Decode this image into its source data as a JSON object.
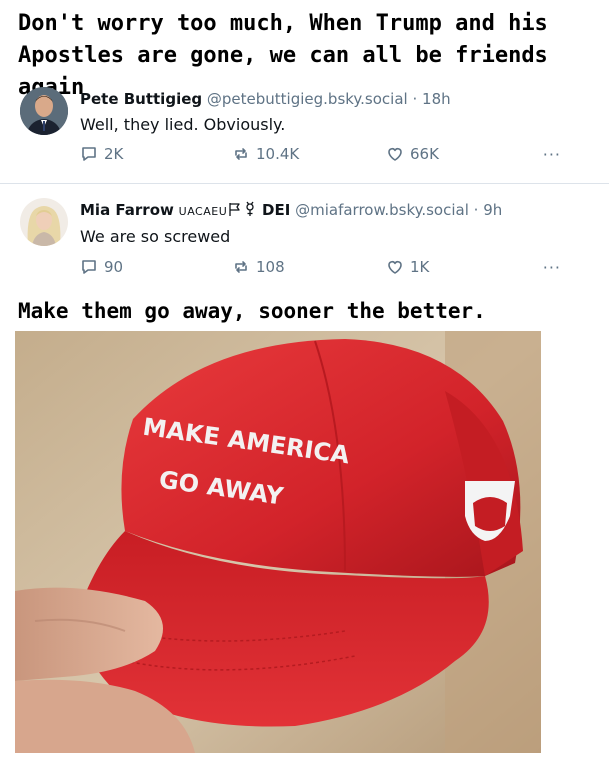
{
  "caption_top": {
    "line1": "Don't worry too much, When Trump and his",
    "line2": "Apostles are gone, we can all be friends again"
  },
  "posts": [
    {
      "name": "Pete Buttigieg",
      "handle": "@petebuttigieg.bsky.social",
      "time": "· 18h",
      "text": "Well, they lied. Obviously.",
      "replies": "2K",
      "reposts": "10.4K",
      "likes": "66K",
      "more": "···"
    },
    {
      "name": "Mia Farrow",
      "name_extra": "UACAEU",
      "badge": "DEI",
      "handle": "@miafarrow.bsky.social",
      "time": "· 9h",
      "text": "We are so screwed",
      "replies": "90",
      "reposts": "108",
      "likes": "1K",
      "more": "···"
    }
  ],
  "caption_bottom": "Make them go away, sooner the better.",
  "photo": {
    "hat_line1": "MAKE AMERICA",
    "hat_line2": "GO AWAY"
  },
  "colors": {
    "hat_red": "#d8262b",
    "icon_gray": "#5f7385",
    "divider": "#dde3ea"
  }
}
